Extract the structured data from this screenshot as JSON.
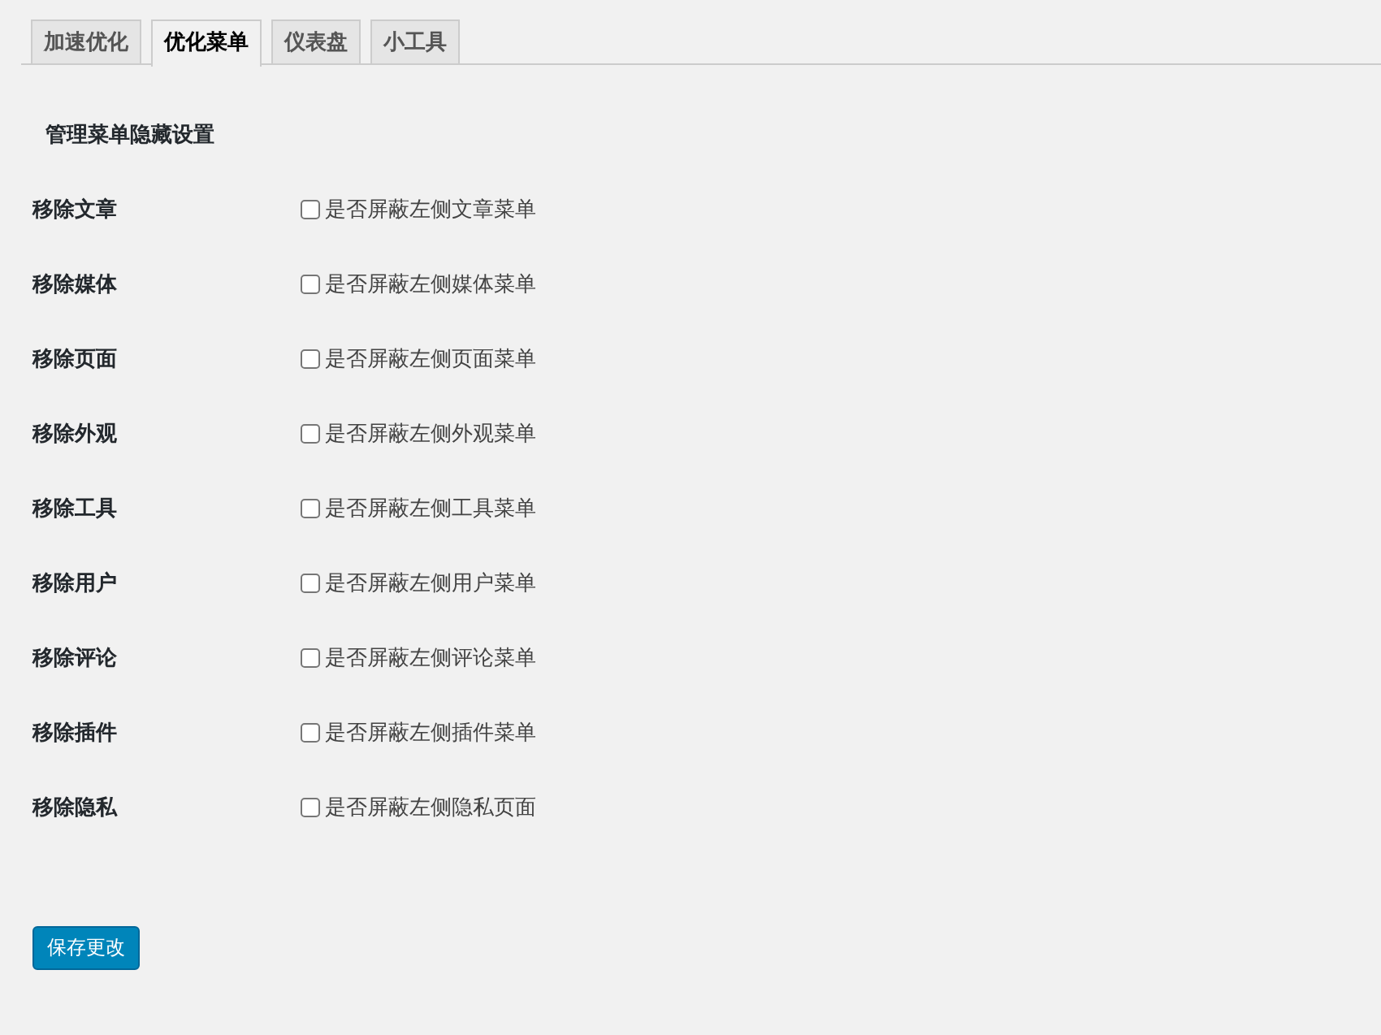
{
  "tabs": [
    {
      "label": "加速优化",
      "selected": false
    },
    {
      "label": "优化菜单",
      "selected": true
    },
    {
      "label": "仪表盘",
      "selected": false
    },
    {
      "label": "小工具",
      "selected": false
    }
  ],
  "section_title": "管理菜单隐藏设置",
  "settings": [
    {
      "label": "移除文章",
      "option": "是否屏蔽左侧文章菜单",
      "checked": false
    },
    {
      "label": "移除媒体",
      "option": "是否屏蔽左侧媒体菜单",
      "checked": false
    },
    {
      "label": "移除页面",
      "option": "是否屏蔽左侧页面菜单",
      "checked": false
    },
    {
      "label": "移除外观",
      "option": "是否屏蔽左侧外观菜单",
      "checked": false
    },
    {
      "label": "移除工具",
      "option": "是否屏蔽左侧工具菜单",
      "checked": false
    },
    {
      "label": "移除用户",
      "option": "是否屏蔽左侧用户菜单",
      "checked": false
    },
    {
      "label": "移除评论",
      "option": "是否屏蔽左侧评论菜单",
      "checked": false
    },
    {
      "label": "移除插件",
      "option": "是否屏蔽左侧插件菜单",
      "checked": false
    },
    {
      "label": "移除隐私",
      "option": "是否屏蔽左侧隐私页面",
      "checked": false
    }
  ],
  "save_button": "保存更改"
}
